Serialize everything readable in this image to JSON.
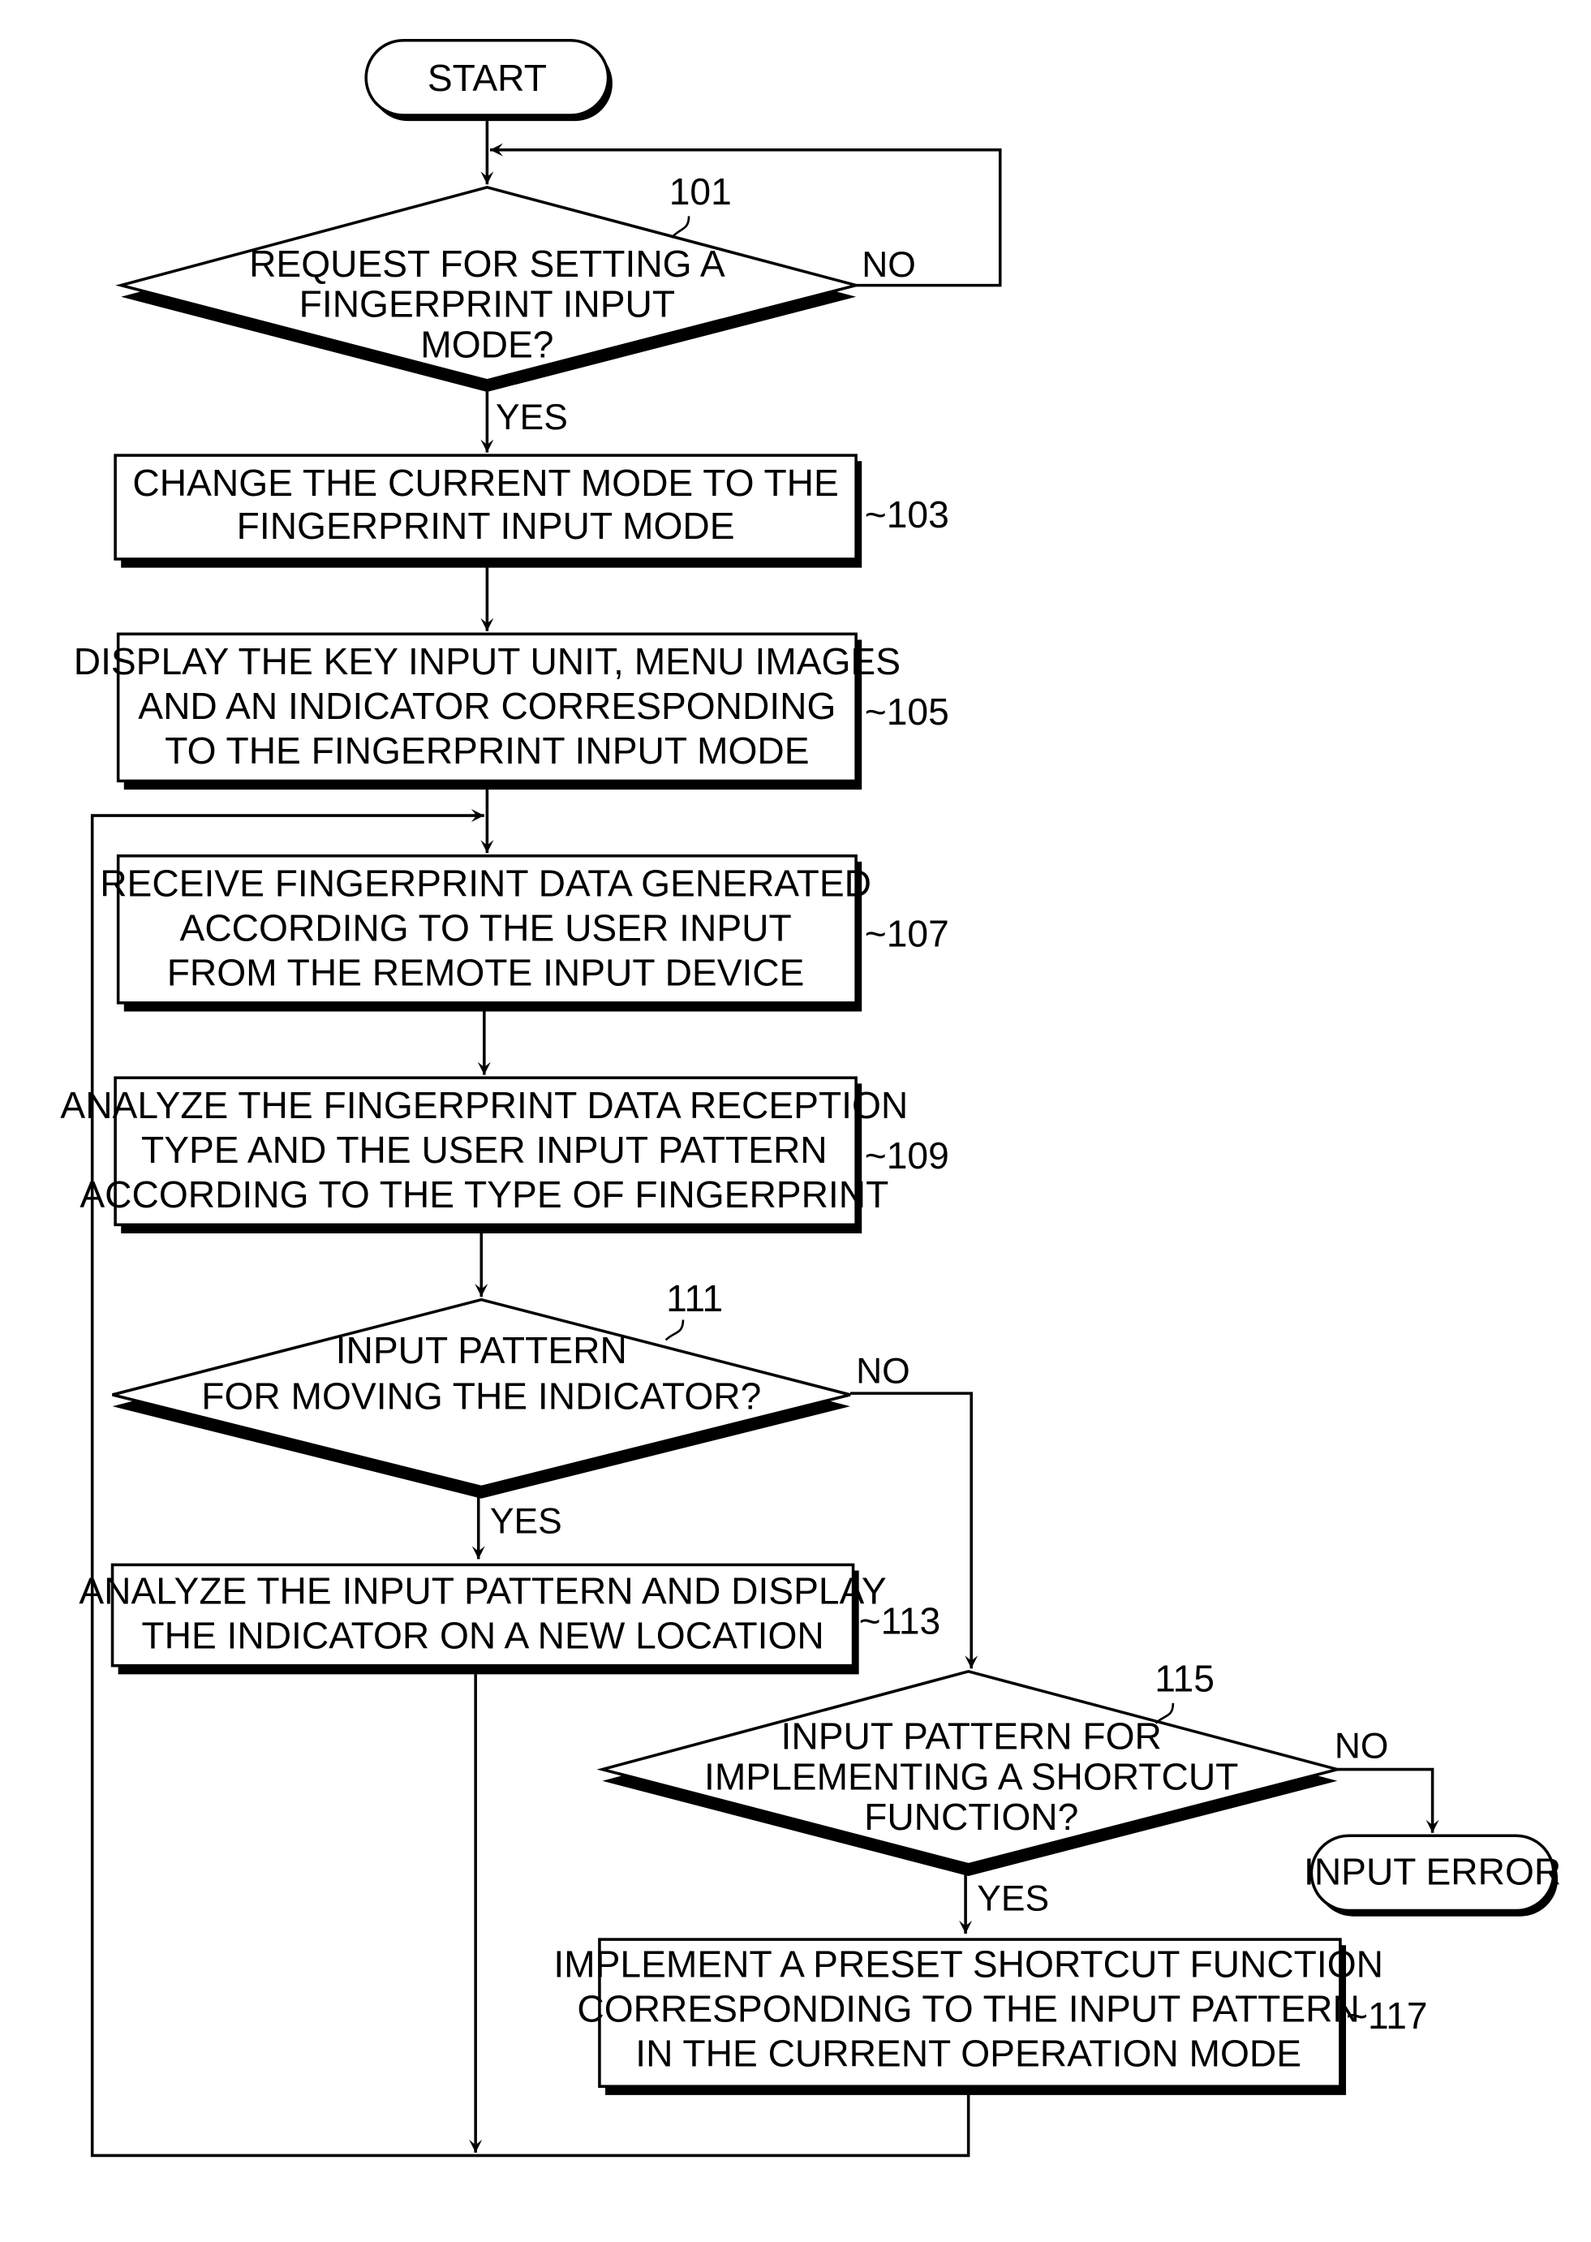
{
  "diagram": {
    "type": "flowchart",
    "terminals": {
      "start": "START",
      "input_error": "INPUT ERROR"
    },
    "steps": [
      {
        "ref": "101",
        "kind": "decision",
        "lines": [
          "REQUEST FOR SETTING A",
          "FINGERPRINT INPUT",
          "MODE?"
        ]
      },
      {
        "ref": "103",
        "kind": "process",
        "lines": [
          "CHANGE THE CURRENT MODE TO THE",
          "FINGERPRINT INPUT MODE"
        ]
      },
      {
        "ref": "105",
        "kind": "process",
        "lines": [
          "DISPLAY THE KEY INPUT UNIT, MENU IMAGES",
          "AND AN INDICATOR CORRESPONDING",
          "TO THE FINGERPRINT INPUT MODE"
        ]
      },
      {
        "ref": "107",
        "kind": "process",
        "lines": [
          "RECEIVE FINGERPRINT DATA GENERATED",
          "ACCORDING TO THE USER INPUT",
          "FROM THE REMOTE INPUT DEVICE"
        ]
      },
      {
        "ref": "109",
        "kind": "process",
        "lines": [
          "ANALYZE THE FINGERPRINT DATA RECEPTION",
          "TYPE AND THE USER INPUT PATTERN",
          "ACCORDING TO THE TYPE OF FINGERPRINT"
        ]
      },
      {
        "ref": "111",
        "kind": "decision",
        "lines": [
          "INPUT PATTERN",
          "FOR MOVING THE INDICATOR?"
        ]
      },
      {
        "ref": "113",
        "kind": "process",
        "lines": [
          "ANALYZE THE INPUT PATTERN AND DISPLAY",
          "THE INDICATOR ON A NEW LOCATION"
        ]
      },
      {
        "ref": "115",
        "kind": "decision",
        "lines": [
          "INPUT PATTERN FOR",
          "IMPLEMENTING A SHORTCUT",
          "FUNCTION?"
        ]
      },
      {
        "ref": "117",
        "kind": "process",
        "lines": [
          "IMPLEMENT A PRESET SHORTCUT FUNCTION",
          "CORRESPONDING TO THE INPUT PATTERN",
          "IN THE CURRENT OPERATION MODE"
        ]
      }
    ],
    "edge_labels": {
      "yes": "YES",
      "no": "NO"
    },
    "ref_prefix": "~"
  }
}
